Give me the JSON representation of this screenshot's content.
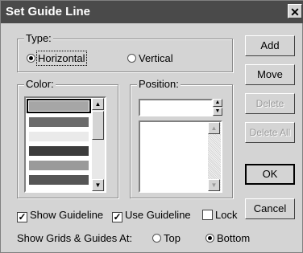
{
  "window": {
    "title": "Set Guide Line",
    "close_glyph": "✕"
  },
  "type_group": {
    "label": "Type:",
    "options": [
      {
        "label": "Horizontal",
        "selected": true
      },
      {
        "label": "Vertical",
        "selected": false
      }
    ]
  },
  "color_group": {
    "label": "Color:",
    "swatches": [
      "#a6a6a6",
      "#6b6b6b",
      "#eaeaea",
      "#3c3c3c",
      "#9a9a9a",
      "#555555"
    ]
  },
  "position_group": {
    "label": "Position:",
    "value": ""
  },
  "buttons": {
    "add": "Add",
    "move": "Move",
    "delete": "Delete",
    "delete_all": "Delete All",
    "ok": "OK",
    "cancel": "Cancel"
  },
  "checks": [
    {
      "label": "Show Guideline",
      "checked": true
    },
    {
      "label": "Use Guideline",
      "checked": true
    },
    {
      "label": "Lock",
      "checked": false
    }
  ],
  "show_at": {
    "label": "Show Grids & Guides At:",
    "options": [
      {
        "label": "Top",
        "selected": false
      },
      {
        "label": "Bottom",
        "selected": true
      }
    ]
  }
}
